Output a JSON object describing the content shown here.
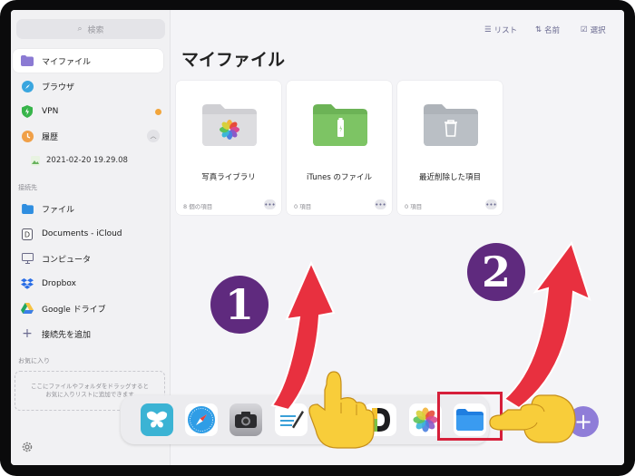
{
  "sidebar": {
    "search_placeholder": "検索",
    "items": [
      {
        "label": "マイファイル",
        "icon": "folder-icon"
      },
      {
        "label": "ブラウザ",
        "icon": "compass-icon"
      },
      {
        "label": "VPN",
        "icon": "shield-icon"
      },
      {
        "label": "履歴",
        "icon": "clock-icon"
      },
      {
        "label": "2021-02-20 19.29.08",
        "icon": "photo-icon"
      }
    ],
    "connections_label": "接続先",
    "connections": [
      {
        "label": "ファイル",
        "icon": "folder-icon"
      },
      {
        "label": "Documents - iCloud",
        "icon": "document-icon"
      },
      {
        "label": "コンピュータ",
        "icon": "monitor-icon"
      },
      {
        "label": "Dropbox",
        "icon": "dropbox-icon"
      },
      {
        "label": "Google ドライブ",
        "icon": "google-drive-icon"
      },
      {
        "label": "接続先を追加",
        "icon": "plus-icon"
      }
    ],
    "favorites_label": "お気に入り",
    "favorites_hint_line1": "ここにファイルやフォルダをドラッグすると",
    "favorites_hint_line2": "お気に入りリストに追加できます"
  },
  "toolbar": {
    "list_label": "リスト",
    "sort_label": "名前",
    "select_label": "選択"
  },
  "main": {
    "title": "マイファイル",
    "folders": [
      {
        "name": "写真ライブラリ",
        "count": "8 個の項目",
        "color": "#d9d9dc"
      },
      {
        "name": "iTunes のファイル",
        "count": "0 項目",
        "color": "#7dc464"
      },
      {
        "name": "最近削除した項目",
        "count": "0 項目",
        "color": "#b9bec4"
      }
    ]
  },
  "dock": {
    "apps": [
      "butterfly-app-icon",
      "safari-icon",
      "camera-icon",
      "notes-pen-icon",
      "hand-pointer-icon",
      "d-app-icon",
      "photos-icon",
      "files-icon"
    ]
  },
  "annotations": {
    "step1": "1",
    "step2": "2",
    "accent": "#e8303f",
    "badge_color": "#5f2a7e"
  }
}
